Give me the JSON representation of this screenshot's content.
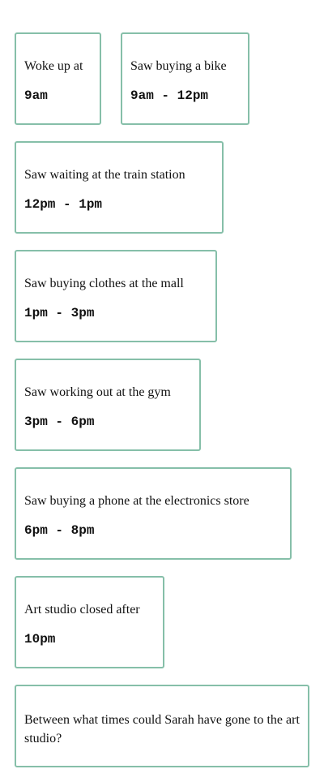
{
  "cards": [
    {
      "label": "Woke up at",
      "time": "9am"
    },
    {
      "label": "Saw buying a bike",
      "time": "9am - 12pm"
    },
    {
      "label": "Saw waiting at the train station",
      "time": "12pm - 1pm"
    },
    {
      "label": "Saw buying clothes at the mall",
      "time": "1pm - 3pm"
    },
    {
      "label": "Saw working out at the gym",
      "time": "3pm - 6pm"
    },
    {
      "label": "Saw buying a phone at the electronics store",
      "time": "6pm - 8pm"
    },
    {
      "label": "Art studio closed after",
      "time": "10pm"
    }
  ],
  "question": {
    "text": "Between what times could Sarah have gone to the art studio?"
  },
  "colors": {
    "card_border": "#86bfa9"
  }
}
